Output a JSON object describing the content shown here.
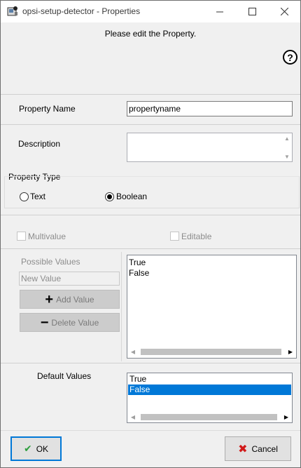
{
  "window": {
    "title": "opsi-setup-detector - Properties",
    "controls": {
      "minimize": "—",
      "maximize": "☐",
      "close": "✕"
    }
  },
  "header": {
    "instruction": "Please edit the Property.",
    "help": "?"
  },
  "form": {
    "property_name_label": "Property Name",
    "property_name_value": "propertyname",
    "description_label": "Description",
    "description_value": "",
    "property_type_label": "Property Type",
    "type_options": [
      {
        "label": "Text",
        "checked": false
      },
      {
        "label": "Boolean",
        "checked": true
      }
    ],
    "multivalue_label": "Multivalue",
    "editable_label": "Editable",
    "possible_values_label": "Possible Values",
    "new_value_placeholder": "New Value",
    "add_value_label": "Add Value",
    "delete_value_label": "Delete Value",
    "possible_values": [
      "True",
      "False"
    ],
    "default_values_label": "Default Values",
    "default_values": [
      {
        "label": "True",
        "selected": false
      },
      {
        "label": "False",
        "selected": true
      }
    ]
  },
  "buttons": {
    "ok_label": "OK",
    "cancel_label": "Cancel"
  },
  "colors": {
    "selection": "#0078d7",
    "ok_icon": "#2e9e3e",
    "cancel_icon": "#d11a1a"
  }
}
